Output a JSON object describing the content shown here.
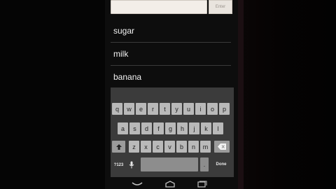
{
  "entry": {
    "value": "",
    "placeholder": "",
    "enter_label": "Enter"
  },
  "list": {
    "items": [
      "sugar",
      "milk",
      "banana"
    ]
  },
  "keyboard": {
    "row1": [
      "q",
      "w",
      "e",
      "r",
      "t",
      "y",
      "u",
      "i",
      "o",
      "p"
    ],
    "row2": [
      "a",
      "s",
      "d",
      "f",
      "g",
      "h",
      "j",
      "k",
      "l"
    ],
    "row3": [
      "z",
      "x",
      "c",
      "v",
      "b",
      "n",
      "m"
    ],
    "symbols_label": "?123",
    "mic_icon": "microphone-icon",
    "shift_icon": "shift-icon",
    "backspace_icon": "backspace-icon",
    "period_label": ".",
    "done_label": "Done"
  },
  "nav": {
    "back_icon": "back-icon",
    "home_icon": "home-icon",
    "recents_icon": "recents-icon"
  }
}
